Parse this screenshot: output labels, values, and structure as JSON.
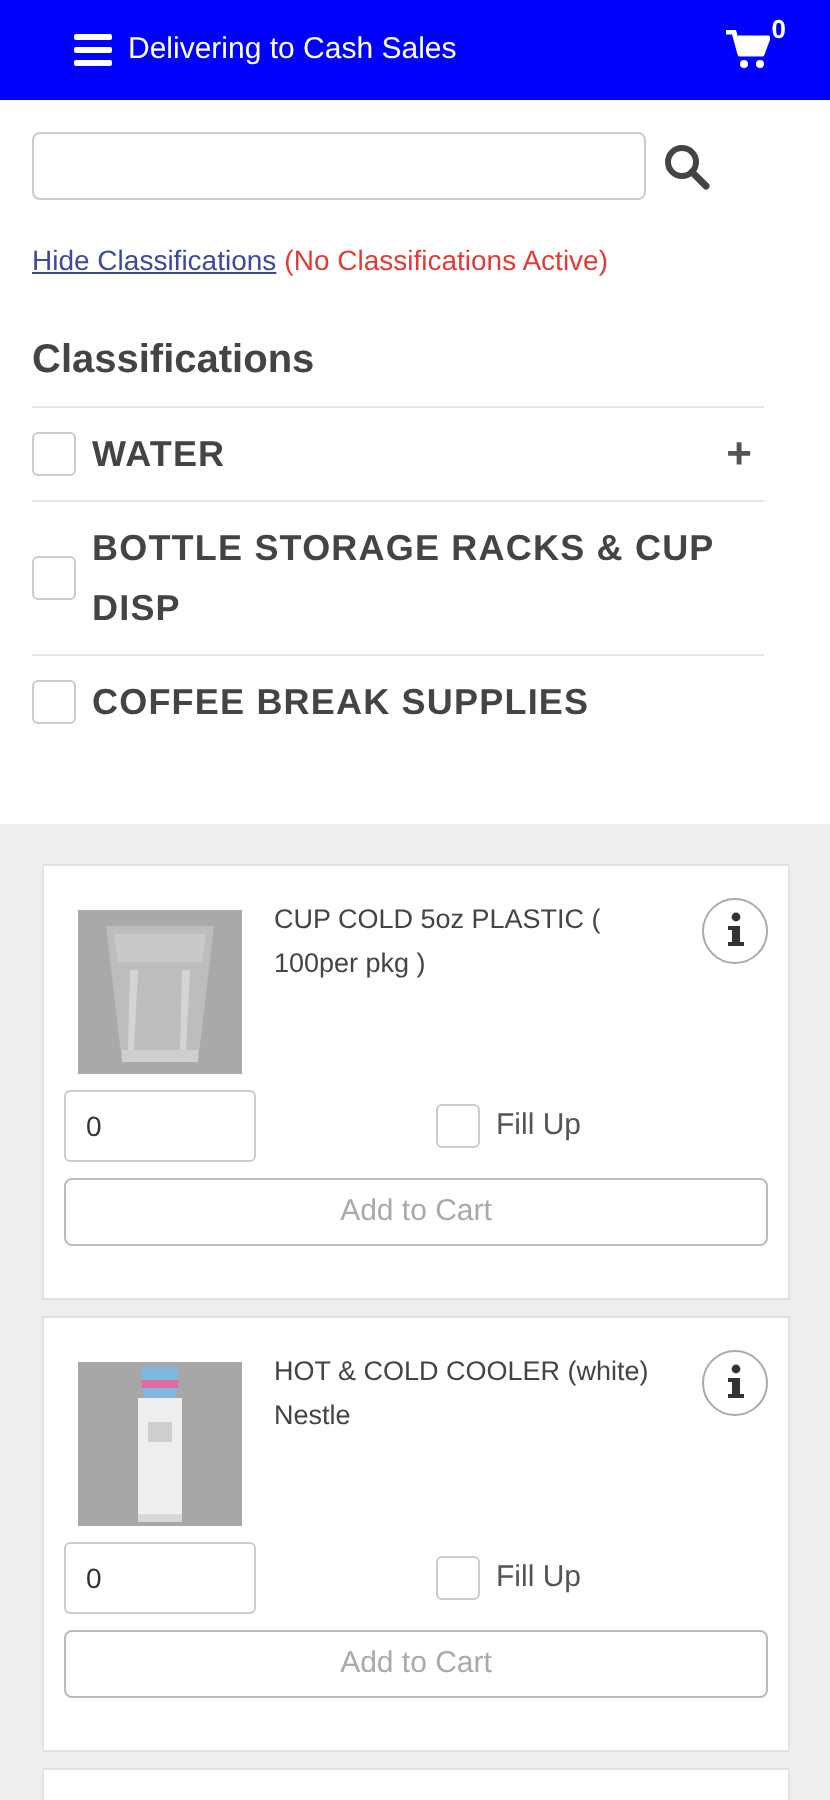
{
  "header": {
    "title": "Delivering to Cash Sales",
    "cart_count": "0"
  },
  "classification_toggle": {
    "link": "Hide Classifications",
    "status": "(No Classifications Active)"
  },
  "classifications": {
    "heading": "Classifications",
    "items": [
      {
        "label": "WATER",
        "checked": false,
        "expandable": true,
        "expand_symbol": "+"
      },
      {
        "label": "BOTTLE STORAGE RACKS & CUP DISP",
        "checked": false,
        "expandable": false
      },
      {
        "label": "COFFEE BREAK SUPPLIES",
        "checked": false,
        "expandable": false
      }
    ]
  },
  "products": [
    {
      "name": "CUP COLD 5oz PLASTIC ( 100per pkg )",
      "quantity": "0",
      "fill_up": {
        "label": "Fill Up",
        "checked": false
      },
      "add_button": {
        "label": "Add to Cart",
        "disabled": true
      }
    },
    {
      "name": "HOT & COLD COOLER (white) Nestle",
      "quantity": "0",
      "fill_up": {
        "label": "Fill Up",
        "checked": false
      },
      "add_button": {
        "label": "Add to Cart",
        "disabled": true
      }
    }
  ]
}
